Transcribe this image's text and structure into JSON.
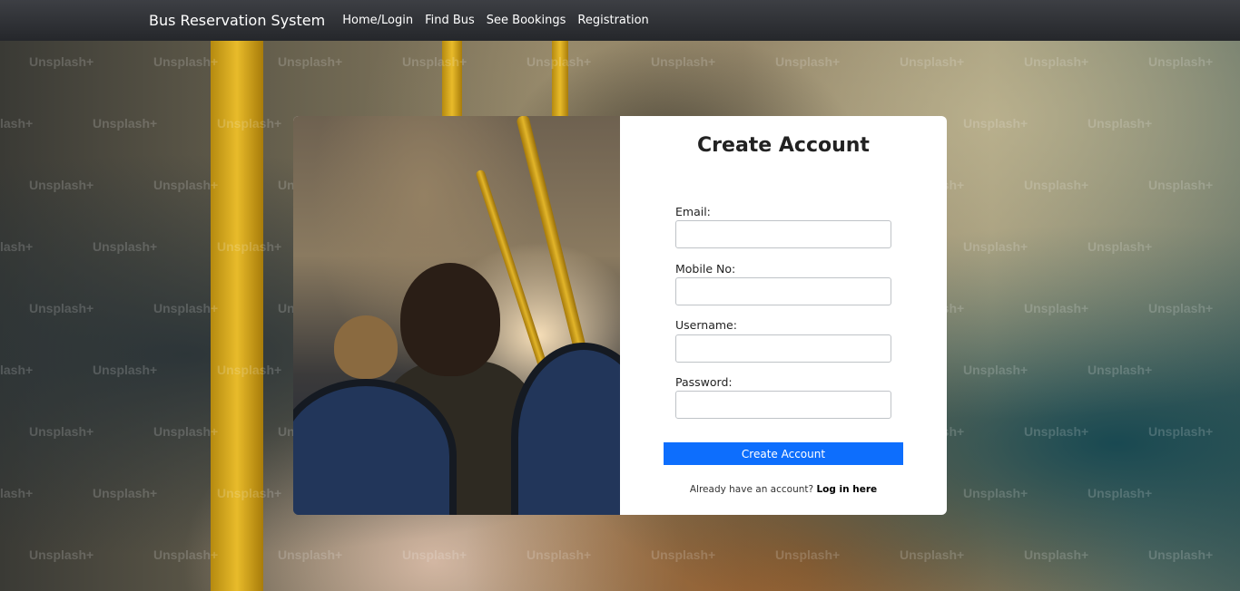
{
  "navbar": {
    "brand": "Bus Reservation System",
    "links": [
      "Home/Login",
      "Find Bus",
      "See Bookings",
      "Registration"
    ]
  },
  "background": {
    "watermark_text": "Unsplash+"
  },
  "form": {
    "title": "Create Account",
    "fields": [
      {
        "label": "Email:",
        "value": "",
        "type": "email"
      },
      {
        "label": "Mobile No:",
        "value": "",
        "type": "tel"
      },
      {
        "label": "Username:",
        "value": "",
        "type": "text"
      },
      {
        "label": "Password:",
        "value": "",
        "type": "password"
      }
    ],
    "submit_label": "Create Account",
    "login_prompt": "Already have an account?",
    "login_link": "Log in here"
  },
  "colors": {
    "navbar": "#2b2d31",
    "primary_button": "#0d6efd"
  }
}
